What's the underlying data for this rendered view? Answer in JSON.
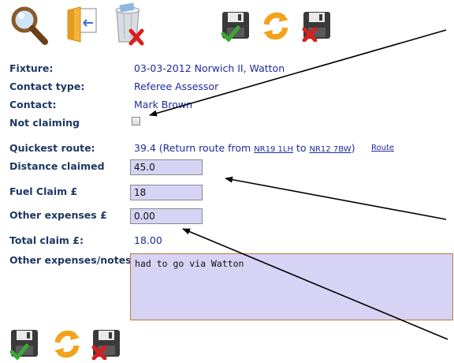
{
  "toolbar": {
    "search_icon": "magnifier-icon",
    "folder_icon": "open-folder-icon",
    "trash_icon": "recycle-bin-delete-icon",
    "save_icon": "save-disk-check-icon",
    "refresh_icon": "refresh-arrows-icon",
    "cancel_icon": "save-disk-cross-icon"
  },
  "form": {
    "fixture_label": "Fixture:",
    "fixture_value": "03-03-2012 Norwich II, Watton",
    "contact_type_label": "Contact type:",
    "contact_type_value": "Referee Assessor",
    "contact_label": "Contact:",
    "contact_value": "Mark Brown",
    "not_claiming_label": "Not claiming",
    "not_claiming_checked": false,
    "quickest_route_label": "Quickest route:",
    "quickest_route_prefix": "39.4 (Return route from ",
    "route_from": "NR19 1LH",
    "route_to_word": " to ",
    "route_to": "NR12 7BW",
    "route_suffix": ")",
    "route_link": "Route",
    "distance_label": "Distance claimed",
    "distance_value": "45.0",
    "fuel_label": "Fuel Claim £",
    "fuel_value": "18",
    "other_label": "Other expenses £",
    "other_value": "0.00",
    "total_label": "Total claim £:",
    "total_value": "18.00",
    "notes_label": "Other expenses/notes",
    "notes_value": "had to go via Watton"
  },
  "colors": {
    "label": "#1f3864",
    "value": "#1f2aa0",
    "input_bg": "#d6d3f5",
    "notes_border": "#c07a3a"
  }
}
